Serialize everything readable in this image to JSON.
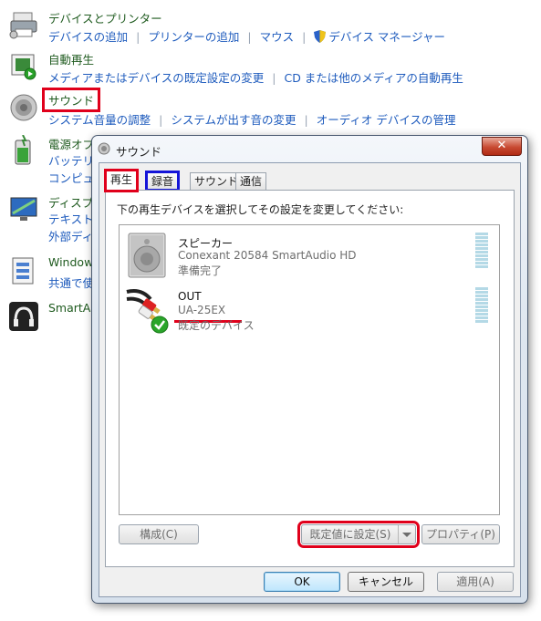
{
  "control_panel": {
    "devices": {
      "title": "デバイスとプリンター",
      "links": [
        "デバイスの追加",
        "プリンターの追加",
        "マウス",
        "デバイス マネージャー"
      ]
    },
    "autoplay": {
      "title": "自動再生",
      "links": [
        "メディアまたはデバイスの既定設定の変更",
        "CD または他のメディアの自動再生"
      ]
    },
    "sound": {
      "title": "サウンド",
      "links": [
        "システム音量の調整",
        "システムが出す音の変更",
        "オーディオ デバイスの管理"
      ]
    },
    "power": {
      "title": "電源オプ",
      "lines": [
        "バッテリ",
        "コンピュ"
      ]
    },
    "display": {
      "title": "ディスプ",
      "lines": [
        "テキスト",
        "外部ディ"
      ]
    },
    "windows": {
      "title": "Window",
      "lines": [
        "共通で使"
      ]
    },
    "smartaudio": {
      "title": "SmartA"
    }
  },
  "dialog": {
    "title": "サウンド",
    "close": "✕",
    "tabs": [
      "再生",
      "録音",
      "サウンド",
      "通信"
    ],
    "instruction": "下の再生デバイスを選択してその設定を変更してください:",
    "devices": [
      {
        "name": "スピーカー",
        "description": "Conexant 20584 SmartAudio HD",
        "status": "準備完了"
      },
      {
        "name": "OUT",
        "description": "UA-25EX",
        "status": "既定のデバイス"
      }
    ],
    "buttons": {
      "configure": "構成(C)",
      "set_default": "既定値に設定(S)",
      "properties": "プロパティ(P)",
      "ok": "OK",
      "cancel": "キャンセル",
      "apply": "適用(A)"
    }
  }
}
